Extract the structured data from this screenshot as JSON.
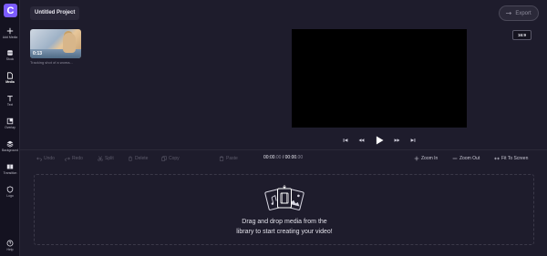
{
  "sidebar": {
    "logo": "C",
    "items": [
      {
        "label": "Add Media",
        "icon": "plus-icon"
      },
      {
        "label": "Stock",
        "icon": "stock-icon"
      },
      {
        "label": "Media",
        "icon": "media-icon"
      },
      {
        "label": "Text",
        "icon": "text-icon"
      },
      {
        "label": "Overlay",
        "icon": "overlay-icon"
      },
      {
        "label": "Background",
        "icon": "background-icon"
      },
      {
        "label": "Transition",
        "icon": "transition-icon"
      },
      {
        "label": "Logo",
        "icon": "shield-icon"
      }
    ],
    "help": {
      "label": "Help",
      "icon": "help-icon"
    }
  },
  "header": {
    "project_title": "Untitled Project",
    "export_label": "Export"
  },
  "media": {
    "duration": "0:13",
    "caption": "Tracking shot of a woma..."
  },
  "preview": {
    "aspect_ratio": "16:9"
  },
  "toolbar": {
    "undo": "Undo",
    "redo": "Redo",
    "split": "Split",
    "delete": "Delete",
    "copy": "Copy",
    "paste": "Paste",
    "timecode_current": "00:00",
    "timecode_current_frac": ".00",
    "timecode_separator": "/",
    "timecode_total": "00:00",
    "timecode_total_frac": ".00",
    "zoom_in": "Zoom In",
    "zoom_out": "Zoom Out",
    "fit_to_screen": "Fit To Screen"
  },
  "dropzone": {
    "line1": "Drag and drop media from the",
    "line2": "library to start creating your video!"
  },
  "colors": {
    "background": "#1e1c2c",
    "sidebar": "#141220",
    "accent": "#7c5cff"
  }
}
